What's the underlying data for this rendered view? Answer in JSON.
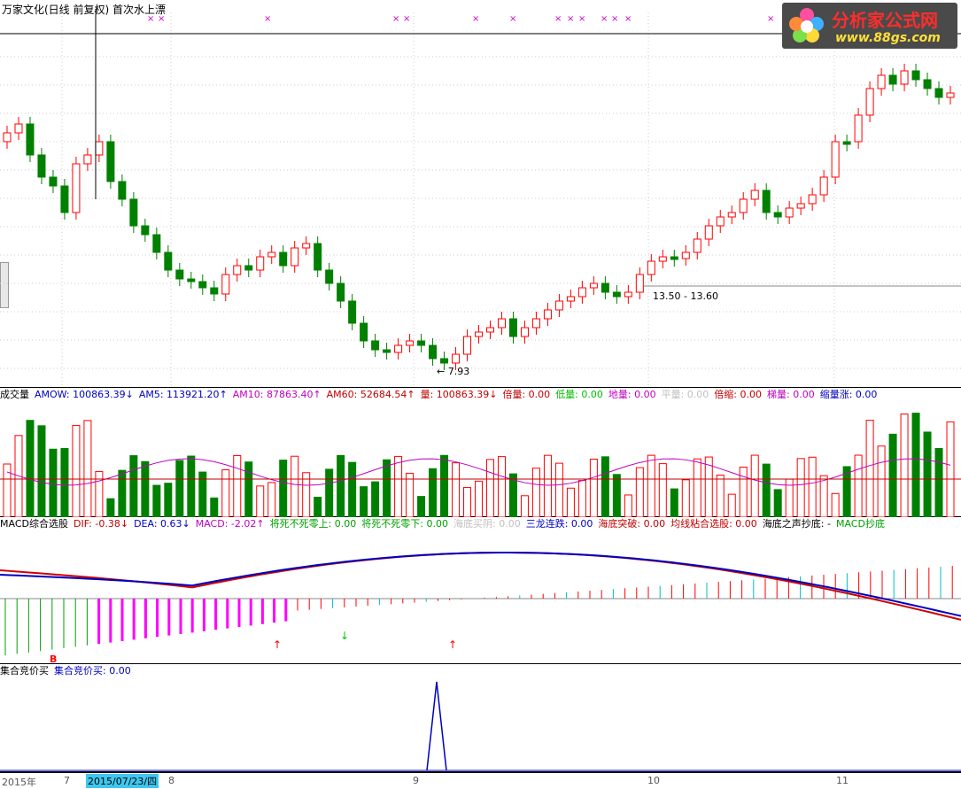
{
  "price_pane": {
    "title": "万家文化(日线 前复权) 首次水上漂",
    "price_low_label": "7.93",
    "range_label": "13.50 - 13.60"
  },
  "volume_pane": {
    "labels": [
      {
        "text": "成交量",
        "color": "#000000"
      },
      {
        "text": "AMOW: 100863.39↓",
        "color": "#0000c0"
      },
      {
        "text": "AM5: 113921.20↑",
        "color": "#0000c0"
      },
      {
        "text": "AM10: 87863.40↑",
        "color": "#c000c0"
      },
      {
        "text": "AM60: 52684.54↑",
        "color": "#c00000"
      },
      {
        "text": "量: 100863.39↓",
        "color": "#c00000"
      },
      {
        "text": "倍量: 0.00",
        "color": "#c00000"
      },
      {
        "text": "低量: 0.00",
        "color": "#00c000"
      },
      {
        "text": "地量: 0.00",
        "color": "#c000c0"
      },
      {
        "text": "平量: 0.00",
        "color": "#c0c0c0"
      },
      {
        "text": "倍缩: 0.00",
        "color": "#c00000"
      },
      {
        "text": "梯量: 0.00",
        "color": "#c000c0"
      },
      {
        "text": "缩量涨: 0.00",
        "color": "#0000c0"
      }
    ]
  },
  "macd_pane": {
    "labels": [
      {
        "text": "MACD综合选股",
        "color": "#000000"
      },
      {
        "text": "DIF: -0.38↓",
        "color": "#c00000"
      },
      {
        "text": "DEA: 0.63↓",
        "color": "#0000c0"
      },
      {
        "text": "MACD: -2.02↑",
        "color": "#c000c0"
      },
      {
        "text": "将死不死零上: 0.00",
        "color": "#00a000"
      },
      {
        "text": "将死不死零下: 0.00",
        "color": "#00a000"
      },
      {
        "text": "海底买阴: 0.00",
        "color": "#c0c0c0"
      },
      {
        "text": "三龙连跌: 0.00",
        "color": "#0000c0"
      },
      {
        "text": "海底突破: 0.00",
        "color": "#c00000"
      },
      {
        "text": "均线粘合选股: 0.00",
        "color": "#c00000"
      },
      {
        "text": "海底之声抄底: -",
        "color": "#000000"
      },
      {
        "text": "MACD抄底",
        "color": "#00a000"
      }
    ],
    "marker_b": "B"
  },
  "auction_pane": {
    "labels": [
      {
        "text": "集合竞价买",
        "color": "#000000"
      },
      {
        "text": "集合竞价买: 0.00",
        "color": "#0000c0"
      }
    ]
  },
  "time_axis": {
    "labels": [
      "2015年",
      "7",
      "8",
      "9",
      "10",
      "11"
    ],
    "selected_date": "2015/07/23/四"
  },
  "logo": {
    "line1": "分析家公式网",
    "line2": "www.88gs.com"
  },
  "colors": {
    "up": "#ff0000",
    "down": "#008000",
    "dif": "#d00000",
    "dea": "#0000c0"
  },
  "chart_data": {
    "type": "candlestick",
    "title": "万家文化(日线 前复权) 首次水上漂",
    "annotations": [
      "7.93",
      "13.50 - 13.60"
    ]
  }
}
